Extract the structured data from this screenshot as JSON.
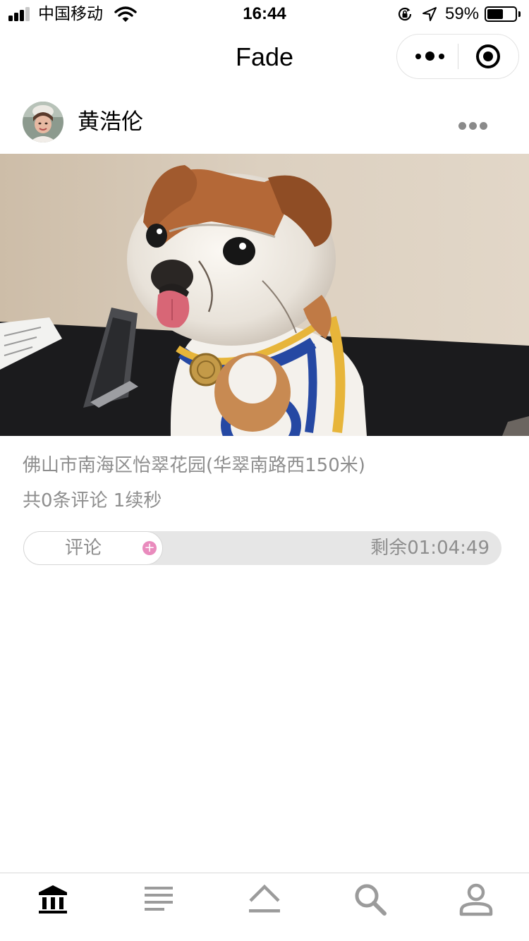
{
  "status_bar": {
    "carrier": "中国移动",
    "time": "16:44",
    "battery_percent": "59%",
    "battery_level": 0.59,
    "signal_bars": 3,
    "icons": [
      "signal-icon",
      "wifi-icon",
      "rotation-lock-icon",
      "location-arrow-icon",
      "battery-icon"
    ]
  },
  "nav": {
    "title": "Fade",
    "capsule_icons": [
      "more-dots-icon",
      "close-target-icon"
    ]
  },
  "post": {
    "author_name": "黄浩伦",
    "location": "佛山市南海区怡翠花园(华翠南路西150米)",
    "stats": "共0条评论 1续秒",
    "comment_label": "评论",
    "comment_icon": "plus-icon",
    "countdown": "剩余01:04:49"
  },
  "tab_bar": {
    "tabs": [
      {
        "icon": "museum-icon",
        "active": true
      },
      {
        "icon": "list-icon",
        "active": false
      },
      {
        "icon": "upload-icon",
        "active": false
      },
      {
        "icon": "search-icon",
        "active": false
      },
      {
        "icon": "profile-icon",
        "active": false
      }
    ]
  },
  "colors": {
    "muted_text": "#8e8e8e",
    "active_tab": "#000000",
    "inactive_tab": "#9b9b9b",
    "plus_accent": "#e98bbd",
    "track": "#e6e6e6"
  }
}
